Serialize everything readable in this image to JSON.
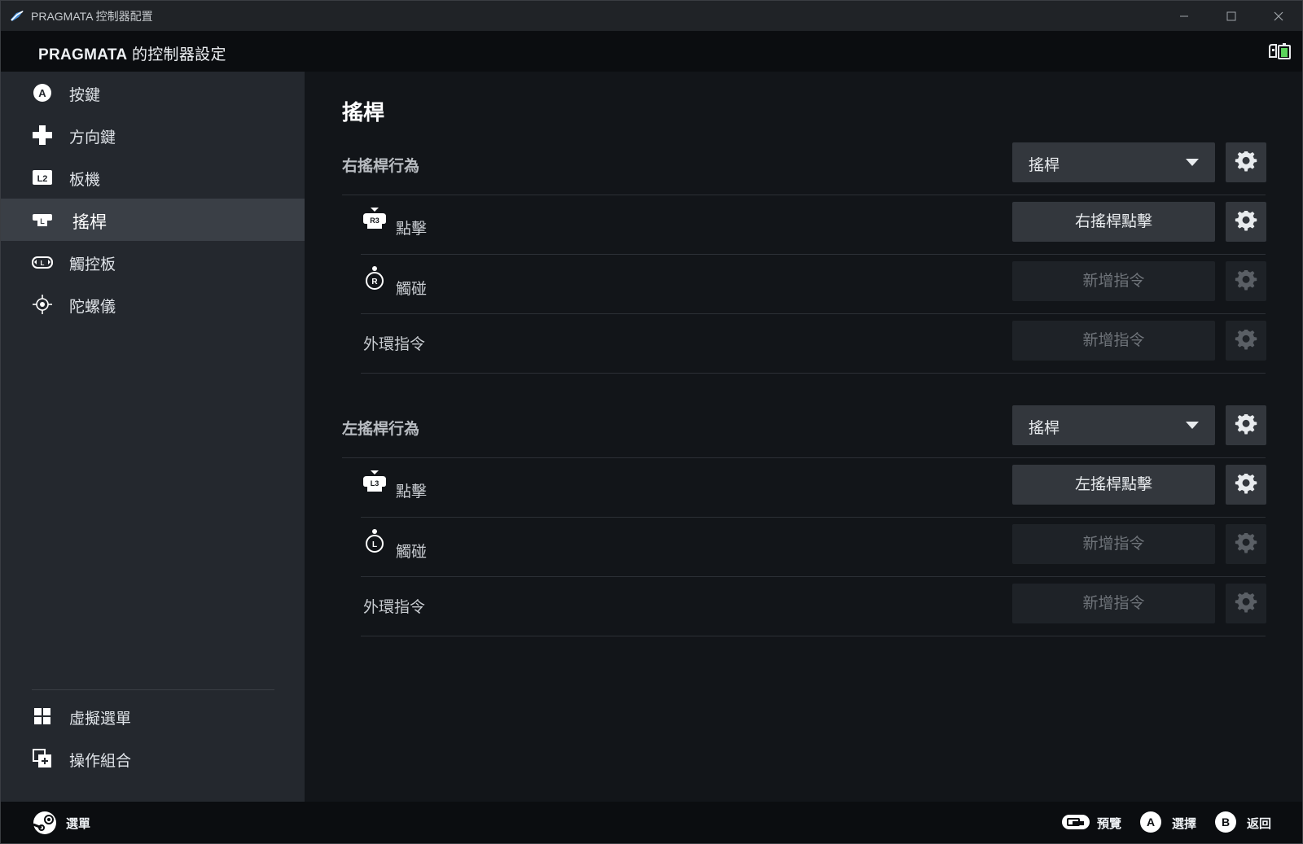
{
  "window": {
    "title": "PRAGMATA 控制器配置",
    "controls": [
      "minimize",
      "maximize",
      "close"
    ]
  },
  "header": {
    "game": "PRAGMATA",
    "title_suffix": " 的控制器設定"
  },
  "sidebar": {
    "items": [
      {
        "label": "按鍵",
        "icon": "a-button-icon"
      },
      {
        "label": "方向鍵",
        "icon": "dpad-icon"
      },
      {
        "label": "板機",
        "icon": "l2-trigger-icon"
      },
      {
        "label": "搖桿",
        "icon": "joystick-icon",
        "active": true
      },
      {
        "label": "觸控板",
        "icon": "trackpad-icon"
      },
      {
        "label": "陀螺儀",
        "icon": "gyro-icon"
      }
    ],
    "bottom_items": [
      {
        "label": "虛擬選單",
        "icon": "virtual-menu-icon"
      },
      {
        "label": "操作組合",
        "icon": "action-set-icon"
      }
    ]
  },
  "main": {
    "section_title": "搖桿",
    "right_stick": {
      "behavior_label": "右搖桿行為",
      "behavior_value": "搖桿",
      "click_label": "點擊",
      "click_command": "右搖桿點擊",
      "touch_label": "觸碰",
      "touch_command": "新增指令",
      "outer_ring_label": "外環指令",
      "outer_ring_command": "新增指令"
    },
    "left_stick": {
      "behavior_label": "左搖桿行為",
      "behavior_value": "搖桿",
      "click_label": "點擊",
      "click_command": "左搖桿點擊",
      "touch_label": "觸碰",
      "touch_command": "新增指令",
      "outer_ring_label": "外環指令",
      "outer_ring_command": "新增指令"
    }
  },
  "footer": {
    "menu_label": "選單",
    "hints": [
      {
        "button": "view-button-icon",
        "label": "預覽"
      },
      {
        "button": "a-button-icon",
        "label": "選擇"
      },
      {
        "button": "b-button-icon",
        "label": "返回"
      }
    ]
  },
  "colors": {
    "background": "#121519",
    "sidebar": "#24282e",
    "sidebar_active": "#3a3f46",
    "button": "#33373d",
    "button_disabled": "#1e2227"
  }
}
